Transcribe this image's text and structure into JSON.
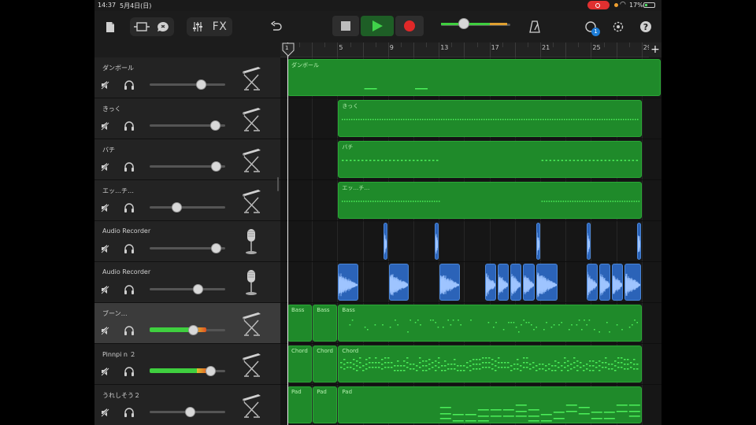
{
  "status": {
    "time": "14:37",
    "date": "5月4日(日)",
    "battery": "17%"
  },
  "toolbar": {
    "fx_label": "FX",
    "notification_count": "1"
  },
  "ruler": {
    "bars": [
      "1",
      "5",
      "9",
      "13",
      "17",
      "21",
      "25",
      "29"
    ],
    "add_label": "+"
  },
  "tracks": [
    {
      "name": "ダンボール",
      "instrument": "keyboard",
      "volume": 0.68,
      "selected": false
    },
    {
      "name": "きっく",
      "instrument": "keyboard",
      "volume": 0.86,
      "selected": false
    },
    {
      "name": "バチ",
      "instrument": "keyboard",
      "volume": 0.88,
      "selected": false
    },
    {
      "name": "エッ…チ…",
      "instrument": "keyboard",
      "volume": 0.35,
      "selected": false
    },
    {
      "name": "Audio Recorder",
      "instrument": "microphone",
      "volume": 0.87,
      "selected": false
    },
    {
      "name": "Audio Recorder",
      "instrument": "microphone",
      "volume": 0.64,
      "selected": false
    },
    {
      "name": "ブーン…",
      "instrument": "keyboard",
      "volume": 0.57,
      "meter": 0.75,
      "selected": true
    },
    {
      "name": "Pinnpi n ２",
      "instrument": "keyboard",
      "volume": 0.8,
      "meter": 0.78,
      "selected": false
    },
    {
      "name": "うれしそう２",
      "instrument": "keyboard",
      "volume": 0.53,
      "selected": false
    }
  ],
  "regions": [
    {
      "track": 0,
      "items": [
        {
          "start": 1,
          "end": 31,
          "label": "ダンボール",
          "notes": "sparse"
        }
      ]
    },
    {
      "track": 1,
      "items": [
        {
          "start": 5,
          "end": 29,
          "label": "きっく",
          "notes": "dotted"
        }
      ]
    },
    {
      "track": 2,
      "items": [
        {
          "start": 5,
          "end": 29,
          "label": "バチ",
          "notes": "dashed-split"
        }
      ]
    },
    {
      "track": 3,
      "items": [
        {
          "start": 5,
          "end": 29,
          "label": "エッ…チ…",
          "notes": "dotted-split"
        }
      ]
    },
    {
      "track": 4,
      "audio": [
        8.6,
        12.6,
        20.6,
        24.6,
        28.6
      ]
    },
    {
      "track": 5,
      "audio_blocks": [
        [
          5,
          6.7
        ],
        [
          9,
          10.7
        ],
        [
          13,
          14.7
        ],
        [
          16.6,
          17.6
        ],
        [
          17.6,
          18.6
        ],
        [
          18.6,
          19.6
        ],
        [
          19.6,
          20.6
        ],
        [
          20.6,
          22.4
        ],
        [
          24.6,
          25.6
        ],
        [
          25.6,
          26.6
        ],
        [
          26.6,
          27.6
        ],
        [
          27.6,
          29
        ]
      ]
    },
    {
      "track": 6,
      "items": [
        {
          "start": 1,
          "end": 3,
          "label": "Bass"
        },
        {
          "start": 3,
          "end": 5,
          "label": "Bass"
        },
        {
          "start": 5,
          "end": 29,
          "label": "Bass",
          "notes": "scatter"
        }
      ]
    },
    {
      "track": 7,
      "items": [
        {
          "start": 1,
          "end": 3,
          "label": "Chord"
        },
        {
          "start": 3,
          "end": 5,
          "label": "Chord"
        },
        {
          "start": 5,
          "end": 29,
          "label": "Chord",
          "notes": "chords"
        }
      ]
    },
    {
      "track": 8,
      "items": [
        {
          "start": 1,
          "end": 3,
          "label": "Pad"
        },
        {
          "start": 3,
          "end": 5,
          "label": "Pad"
        },
        {
          "start": 5,
          "end": 29,
          "label": "Pad",
          "notes": "pads"
        }
      ]
    }
  ],
  "colors": {
    "midi": "#1f8a2a",
    "audio": "#2b63b8",
    "accent": "#2aa836",
    "record": "#e02828"
  }
}
